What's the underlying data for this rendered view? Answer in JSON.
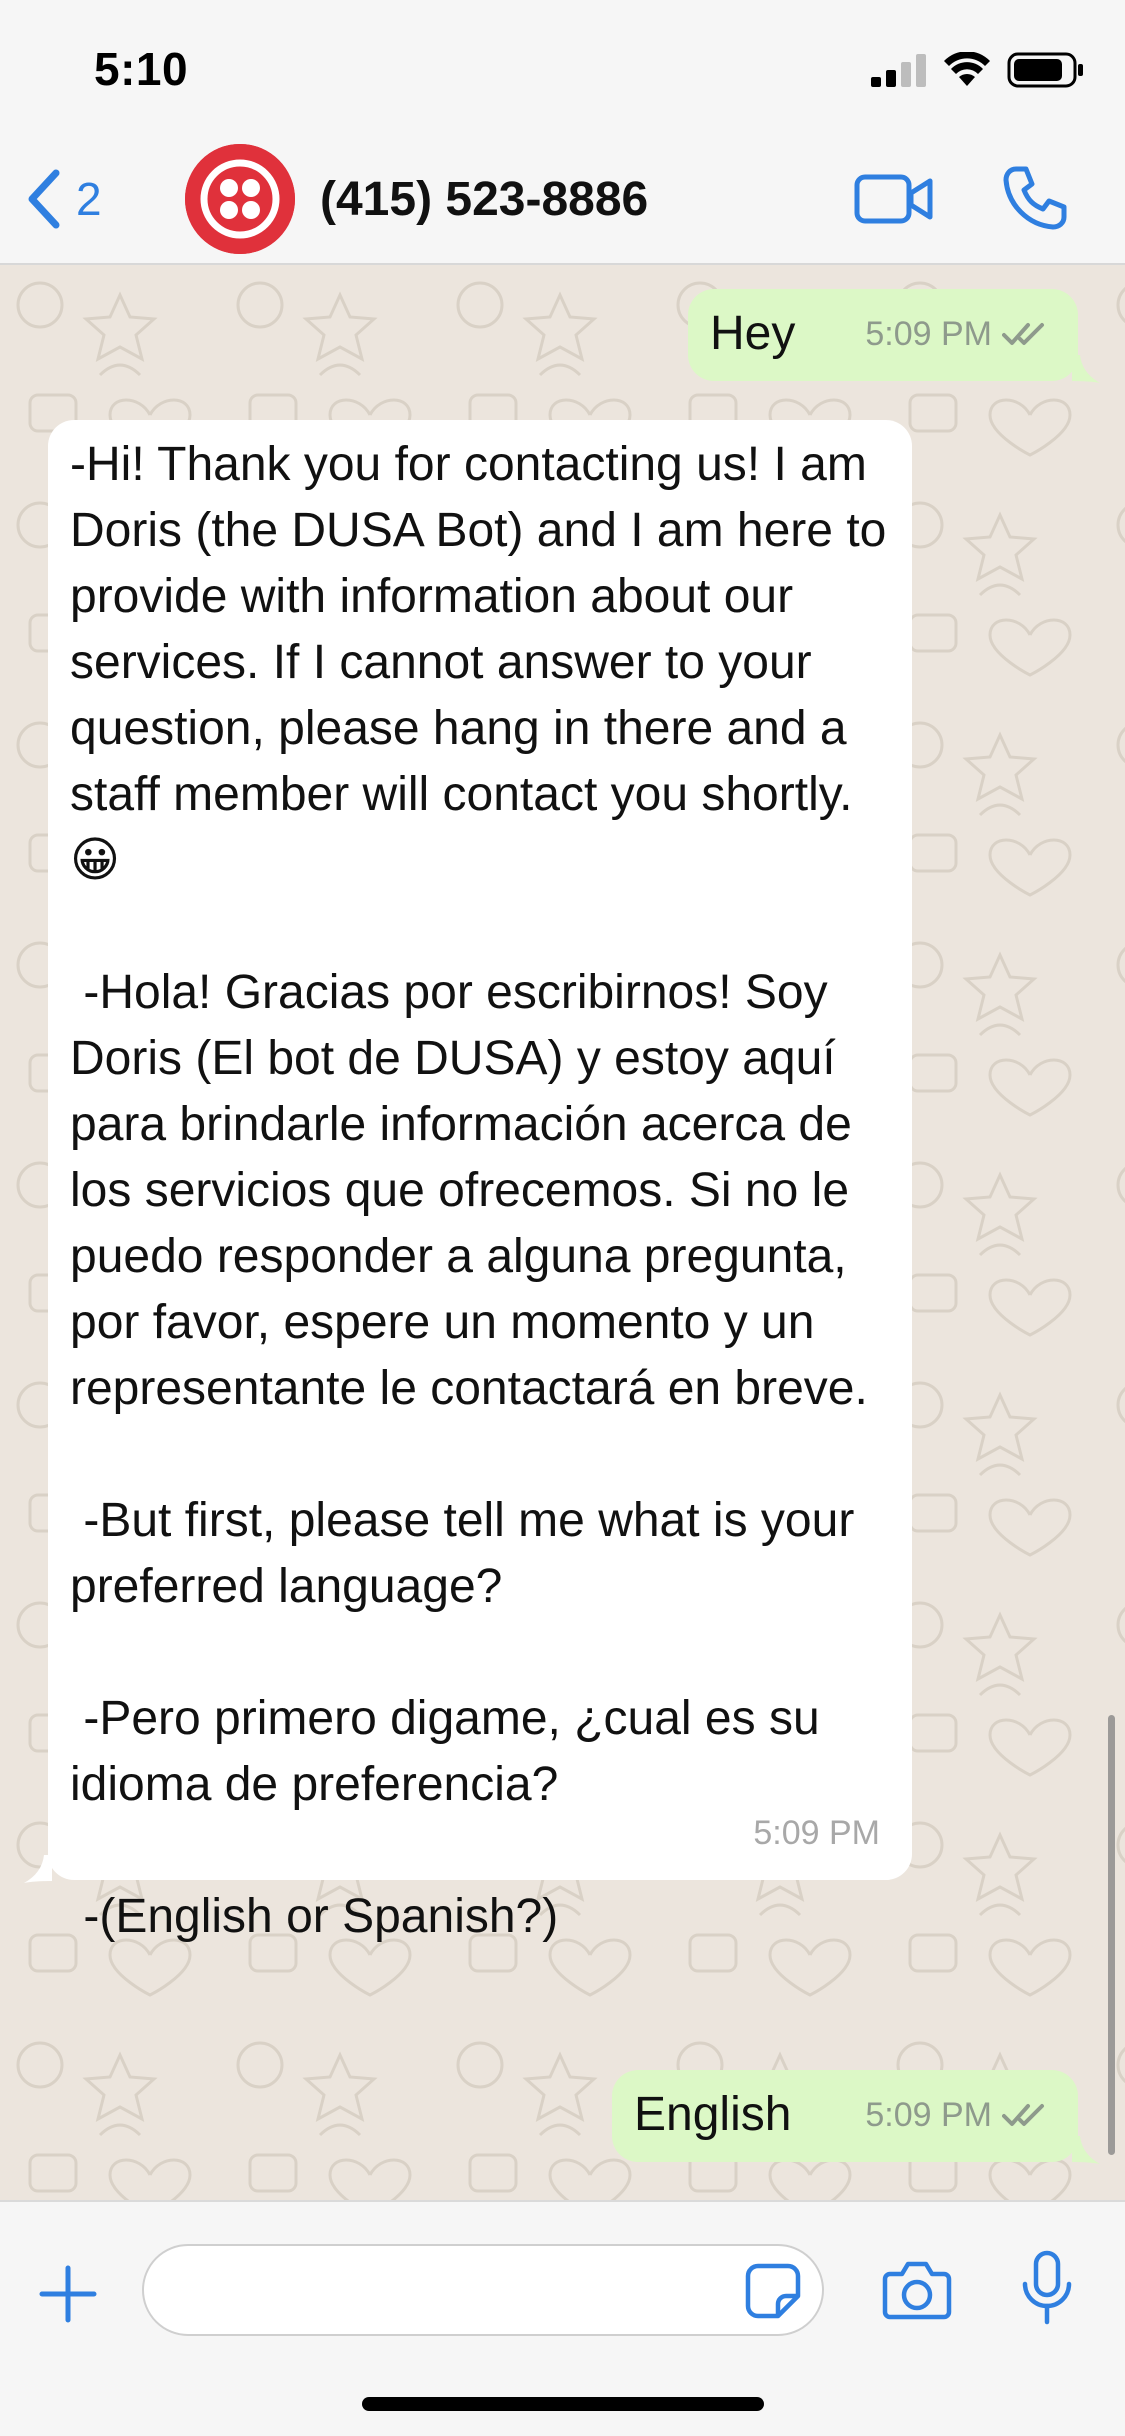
{
  "status_bar": {
    "time": "5:10"
  },
  "nav": {
    "back_count": "2",
    "contact_name": "(415) 523-8886"
  },
  "messages": [
    {
      "direction": "out",
      "text": "Hey",
      "time": "5:09 PM",
      "read": true
    },
    {
      "direction": "in",
      "text": "-Hi! Thank you for contacting us! I am Doris (the DUSA Bot) and I am here to provide with information about our services. If I cannot answer to your question, please hang in there and a staff member will contact you shortly. 😀\n\n -Hola! Gracias por escribirnos! Soy Doris (El bot de DUSA) y estoy aquí para brindarle información acerca de los servicios que ofrecemos. Si no le puedo responder a alguna pregunta, por favor, espere un momento y un representante le contactará en breve.\n\n -But first, please tell me what is your preferred language?\n\n -Pero primero digame, ¿cual es su idioma de preferencia?\n\n -(English or Spanish?)",
      "time": "5:09 PM"
    },
    {
      "direction": "out",
      "text": "English",
      "time": "5:09 PM",
      "read": true
    }
  ],
  "input": {
    "value": "",
    "placeholder": ""
  },
  "colors": {
    "accent": "#2f7fe0",
    "outgoing_bubble": "#dcf8c6",
    "incoming_bubble": "#ffffff",
    "avatar": "#e0313b",
    "chat_background": "#ece5dd"
  }
}
